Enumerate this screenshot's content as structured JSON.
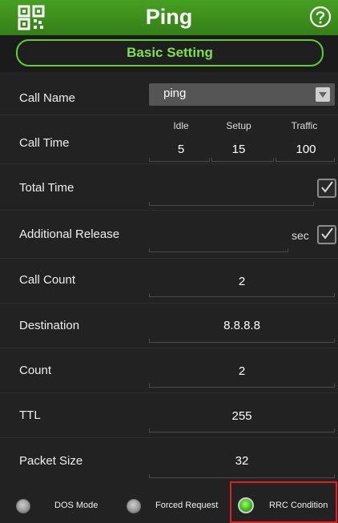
{
  "header": {
    "title": "Ping",
    "icon_left": "qr-code-icon",
    "icon_right": "help-icon"
  },
  "tab": {
    "label": "Basic Setting"
  },
  "rows": {
    "call_name": {
      "label": "Call Name",
      "value": "ping"
    },
    "call_time": {
      "label": "Call Time",
      "columns": [
        {
          "head": "Idle",
          "value": "5"
        },
        {
          "head": "Setup",
          "value": "15"
        },
        {
          "head": "Traffic",
          "value": "100"
        }
      ]
    },
    "total_time": {
      "label": "Total Time",
      "checked": true
    },
    "additional_release": {
      "label": "Additional Release",
      "unit": "sec",
      "checked": true
    },
    "call_count": {
      "label": "Call Count",
      "value": "2"
    },
    "destination": {
      "label": "Destination",
      "value": "8.8.8.8"
    },
    "count": {
      "label": "Count",
      "value": "2"
    },
    "ttl": {
      "label": "TTL",
      "value": "255"
    },
    "packet_size": {
      "label": "Packet Size",
      "value": "32"
    }
  },
  "options": [
    {
      "label": "DOS Mode",
      "selected": false
    },
    {
      "label": "Forced Request",
      "selected": false
    },
    {
      "label": "RRC Condition",
      "selected": true
    }
  ],
  "colors": {
    "header_green": "#3c8f1c",
    "accent_green": "#5fd12a",
    "background": "#222222",
    "highlight_red": "#e02020"
  }
}
